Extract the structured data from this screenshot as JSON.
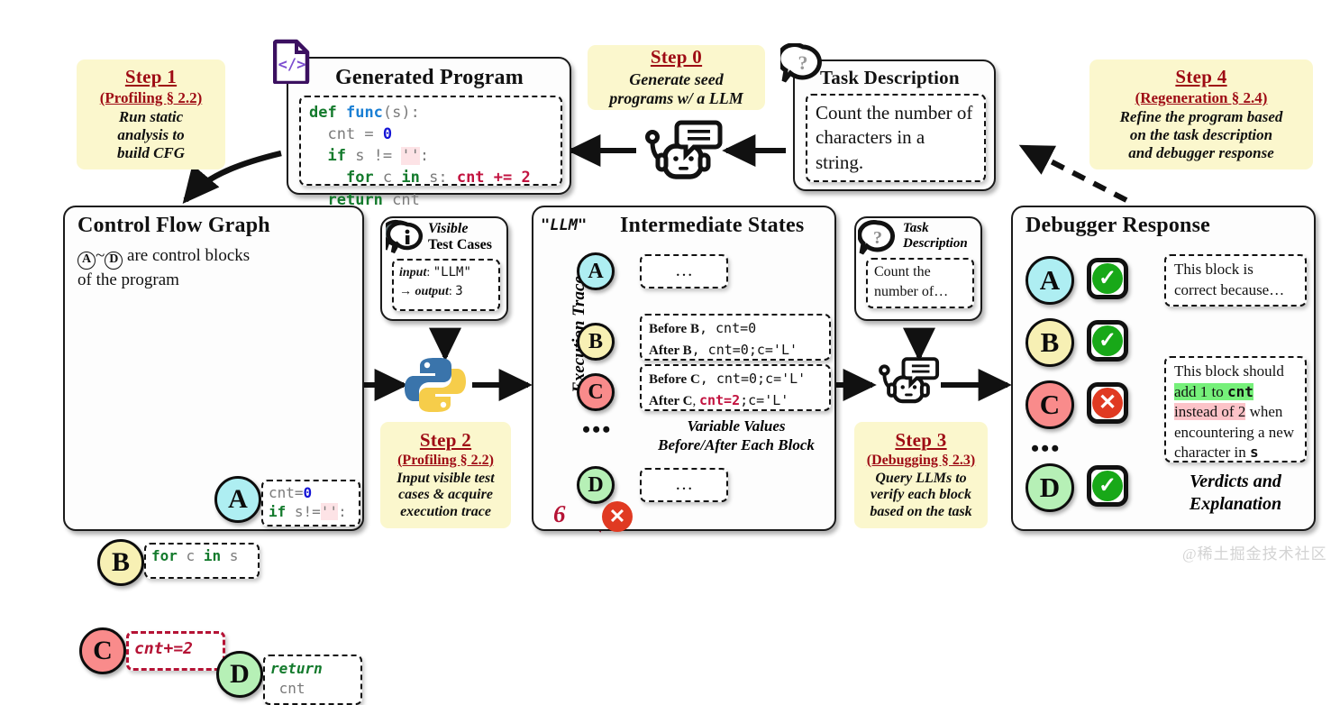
{
  "steps": {
    "step0": {
      "title": "Step 0",
      "sub": "",
      "body": "Generate seed\nprograms  w/ a LLM"
    },
    "step1": {
      "title": "Step 1",
      "sub": "(Profiling § 2.2)",
      "body": "Run static\nanalysis to\nbuild CFG"
    },
    "step2": {
      "title": "Step 2",
      "sub": "(Profiling § 2.2)",
      "body": "Input visible test\ncases & acquire\nexecution trace"
    },
    "step3": {
      "title": "Step 3",
      "sub": "(Debugging § 2.3)",
      "body": "Query LLMs to\nverify each block\nbased on the task"
    },
    "step4": {
      "title": "Step 4",
      "sub": "(Regeneration § 2.4)",
      "body": "Refine the program based\non the task description\nand debugger response"
    }
  },
  "generated_program": {
    "title": "Generated Program",
    "icon": "code-file-icon",
    "code_lines": [
      "def func(s):",
      "  cnt = 0",
      "  if s != '':",
      "    for c in s: cnt += 2",
      "  return cnt"
    ]
  },
  "task_description_main": {
    "title": "Task Description",
    "icon": "question-bubble-icon",
    "text": "Count the number of characters in a string."
  },
  "cfg": {
    "title": "Control Flow Graph",
    "subtitle_prefix": "",
    "subtitle": "are control blocks\nof the program",
    "legend_a": "A",
    "legend_d": "D",
    "nodes": [
      {
        "id": "A",
        "code": "cnt=0\nif s!='':"
      },
      {
        "id": "B",
        "code": "for c in s"
      },
      {
        "id": "C",
        "code": "cnt+=2"
      },
      {
        "id": "D",
        "code": "return\ncnt"
      }
    ]
  },
  "visible_test_cases": {
    "title_line1": "Visible",
    "title_line2": "Test Cases",
    "icon": "info-bubble-icon",
    "input_label": "input",
    "input_value": "\"LLM\"",
    "output_label": "output",
    "output_value": "3",
    "arrow": "→"
  },
  "python_icon": "python-logo-icon",
  "intermediate_states": {
    "title": "Intermediate States",
    "input_literal": "\"LLM\"",
    "trace_label": "Execution Trace",
    "result_value": "6",
    "result_status": "fail",
    "caption": "Variable Values\nBefore/After Each Block",
    "rows": [
      {
        "node": "A",
        "text": "…",
        "kind": "ellipsis"
      },
      {
        "node": "B",
        "before_label": "Before B",
        "before": ", cnt=0",
        "after_label": "After B",
        "after": ", cnt=0;c='L'",
        "kind": "state"
      },
      {
        "node": "C",
        "before_label": "Before C",
        "before": ", cnt=0;c='L'",
        "after_label": "After C",
        "after_highlight": "cnt=2",
        "after": ";c='L'",
        "kind": "state"
      },
      {
        "node": "D",
        "text": "…",
        "kind": "ellipsis"
      }
    ],
    "ellipsis": "…"
  },
  "task_description_small": {
    "title_line1": "Task",
    "title_line2": "Description",
    "icon": "question-bubble-icon",
    "text": "Count the\nnumber of…"
  },
  "robot_icon": "llm-robot-icon",
  "debugger_response": {
    "title": "Debugger Response",
    "caption": "Verdicts and\nExplanation",
    "ellipsis": "…",
    "rows": [
      {
        "node": "A",
        "verdict": "pass",
        "explanation": "This block is\ncorrect because…"
      },
      {
        "node": "B",
        "verdict": "pass",
        "explanation": ""
      },
      {
        "node": "C",
        "verdict": "fail",
        "explanation_parts": [
          {
            "t": "This block should ",
            "style": "plain"
          },
          {
            "t": "add 1 to ",
            "style": "green"
          },
          {
            "t": "cnt",
            "style": "green-mono"
          },
          {
            "t": "instead of 2",
            "style": "pink"
          },
          {
            "t": " when encountering a new character in ",
            "style": "plain"
          },
          {
            "t": "s",
            "style": "mono"
          }
        ]
      },
      {
        "node": "D",
        "verdict": "pass",
        "explanation": ""
      }
    ]
  },
  "watermark": "@稀土掘金技术社区",
  "colors": {
    "note_bg": "#fbf7cd",
    "step_red": "#9e0b14",
    "node_a": "#aeeef2",
    "node_b": "#f7f0b4",
    "node_c": "#f98b8b",
    "node_d": "#b6f0b6",
    "pass_green": "#18a818",
    "fail_red": "#e03a22",
    "code_red": "#c2123f",
    "highlight_green": "#76f07a",
    "highlight_pink": "#fcc3c8"
  }
}
